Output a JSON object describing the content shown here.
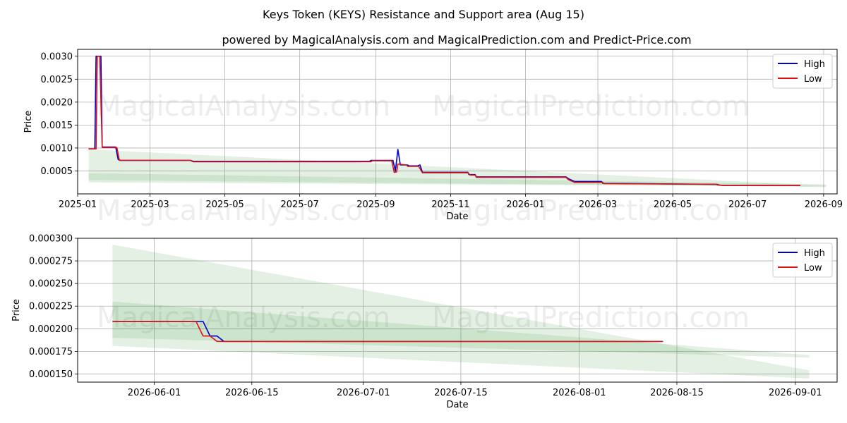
{
  "title": "Keys Token (KEYS) Resistance and Support area (Aug 15)",
  "subtitle": "powered by MagicalAnalysis.com and MagicalPrediction.com and Predict-Price.com",
  "watermarks": [
    "MagicalAnalysis.com",
    "MagicalPrediction.com"
  ],
  "colors": {
    "high": "#0000cc",
    "low": "#dd1111",
    "band": "#2e8b2e",
    "grid": "#b0b0b0"
  },
  "chart_data": [
    {
      "type": "line",
      "xlabel": "Date",
      "ylabel": "Price",
      "xlim": [
        "2025-01-01",
        "2026-09-12"
      ],
      "ylim": [
        0,
        0.00315
      ],
      "xticks": [
        "2025-01",
        "2025-03",
        "2025-05",
        "2025-07",
        "2025-09",
        "2025-11",
        "2026-01",
        "2026-03",
        "2026-05",
        "2026-07",
        "2026-09"
      ],
      "yticks": [
        "0.0005",
        "0.0010",
        "0.0015",
        "0.0020",
        "0.0025",
        "0.0030"
      ],
      "grid": true,
      "legend": {
        "position": "top-right",
        "entries": [
          "High",
          "Low"
        ]
      },
      "series": [
        {
          "name": "High",
          "points": [
            [
              "2025-01-10",
              0.00098
            ],
            [
              "2025-01-15",
              0.00098
            ],
            [
              "2025-01-16",
              0.003
            ],
            [
              "2025-01-20",
              0.003
            ],
            [
              "2025-01-21",
              0.00102
            ],
            [
              "2025-02-01",
              0.00102
            ],
            [
              "2025-02-03",
              0.00075
            ],
            [
              "2025-02-05",
              0.00073
            ],
            [
              "2025-04-03",
              0.00073
            ],
            [
              "2025-04-05",
              0.00071
            ],
            [
              "2025-08-27",
              0.00071
            ],
            [
              "2025-08-28",
              0.00073
            ],
            [
              "2025-09-15",
              0.00073
            ],
            [
              "2025-09-17",
              0.0005
            ],
            [
              "2025-09-19",
              0.00097
            ],
            [
              "2025-09-21",
              0.00063
            ],
            [
              "2025-09-27",
              0.00063
            ],
            [
              "2025-09-28",
              0.00061
            ],
            [
              "2025-10-05",
              0.00061
            ],
            [
              "2025-10-07",
              0.00063
            ],
            [
              "2025-10-09",
              0.00047
            ],
            [
              "2025-11-15",
              0.00047
            ],
            [
              "2025-11-16",
              0.00042
            ],
            [
              "2025-11-21",
              0.00042
            ],
            [
              "2025-11-22",
              0.00037
            ],
            [
              "2026-02-03",
              0.00037
            ],
            [
              "2026-02-05",
              0.00033
            ],
            [
              "2026-02-10",
              0.00027
            ],
            [
              "2026-03-04",
              0.00027
            ],
            [
              "2026-03-05",
              0.00023
            ],
            [
              "2026-06-06",
              0.000208
            ],
            [
              "2026-06-08",
              0.000192
            ],
            [
              "2026-06-11",
              0.000186
            ],
            [
              "2026-08-13",
              0.000186
            ]
          ]
        },
        {
          "name": "Low",
          "points": [
            [
              "2025-01-10",
              0.00098
            ],
            [
              "2025-01-16",
              0.00098
            ],
            [
              "2025-01-17",
              0.003
            ],
            [
              "2025-01-19",
              0.003
            ],
            [
              "2025-01-21",
              0.00101
            ],
            [
              "2025-02-02",
              0.00101
            ],
            [
              "2025-02-04",
              0.00073
            ],
            [
              "2025-04-03",
              0.00073
            ],
            [
              "2025-04-05",
              0.0007
            ],
            [
              "2025-08-28",
              0.0007
            ],
            [
              "2025-08-29",
              0.00072
            ],
            [
              "2025-09-14",
              0.00072
            ],
            [
              "2025-09-16",
              0.00047
            ],
            [
              "2025-09-18",
              0.00048
            ],
            [
              "2025-09-19",
              0.00065
            ],
            [
              "2025-09-26",
              0.00063
            ],
            [
              "2025-09-27",
              0.0006
            ],
            [
              "2025-10-06",
              0.0006
            ],
            [
              "2025-10-09",
              0.00046
            ],
            [
              "2025-11-15",
              0.00046
            ],
            [
              "2025-11-17",
              0.00041
            ],
            [
              "2025-11-21",
              0.00041
            ],
            [
              "2025-11-22",
              0.00036
            ],
            [
              "2026-02-03",
              0.00036
            ],
            [
              "2026-02-05",
              0.00031
            ],
            [
              "2026-02-10",
              0.00025
            ],
            [
              "2026-03-05",
              0.00025
            ],
            [
              "2026-03-06",
              0.000225
            ],
            [
              "2026-06-05",
              0.000208
            ],
            [
              "2026-06-07",
              0.000192
            ],
            [
              "2026-06-10",
              0.000186
            ],
            [
              "2026-08-13",
              0.000186
            ]
          ]
        }
      ],
      "bands": [
        {
          "x": [
            "2025-01-10",
            "2026-09-03"
          ],
          "upper": [
            0.00097,
            0.00018
          ],
          "lower": [
            0.0003,
            0.00015
          ]
        },
        {
          "x": [
            "2025-01-10",
            "2026-09-03"
          ],
          "upper": [
            0.00045,
            0.00021
          ],
          "lower": [
            0.00025,
            0.00016
          ]
        }
      ]
    },
    {
      "type": "line",
      "xlabel": "Date",
      "ylabel": "Price",
      "xlim": [
        "2026-05-21",
        "2026-09-07"
      ],
      "ylim": [
        0.000141,
        0.0003
      ],
      "xticks": [
        "2026-06-01",
        "2026-06-15",
        "2026-07-01",
        "2026-07-15",
        "2026-08-01",
        "2026-08-15",
        "2026-09-01"
      ],
      "yticks": [
        "0.000150",
        "0.000175",
        "0.000200",
        "0.000225",
        "0.000250",
        "0.000275",
        "0.000300"
      ],
      "grid": true,
      "legend": {
        "position": "top-right",
        "entries": [
          "High",
          "Low"
        ]
      },
      "series": [
        {
          "name": "High",
          "points": [
            [
              "2026-05-26",
              0.000208
            ],
            [
              "2026-06-08",
              0.000208
            ],
            [
              "2026-06-09",
              0.000192
            ],
            [
              "2026-06-10",
              0.000192
            ],
            [
              "2026-06-11",
              0.000186
            ],
            [
              "2026-08-13",
              0.000186
            ]
          ]
        },
        {
          "name": "Low",
          "points": [
            [
              "2026-05-26",
              0.000208
            ],
            [
              "2026-06-07",
              0.000208
            ],
            [
              "2026-06-08",
              0.000192
            ],
            [
              "2026-06-09",
              0.000192
            ],
            [
              "2026-06-10",
              0.000186
            ],
            [
              "2026-08-13",
              0.000186
            ]
          ]
        }
      ],
      "bands": [
        {
          "x": [
            "2026-05-26",
            "2026-09-03"
          ],
          "upper": [
            0.000293,
            0.000154
          ],
          "lower": [
            0.000181,
            0.000145
          ]
        },
        {
          "x": [
            "2026-05-26",
            "2026-09-03"
          ],
          "upper": [
            0.00023,
            0.000171
          ],
          "lower": [
            0.00019,
            0.000168
          ]
        }
      ]
    }
  ]
}
